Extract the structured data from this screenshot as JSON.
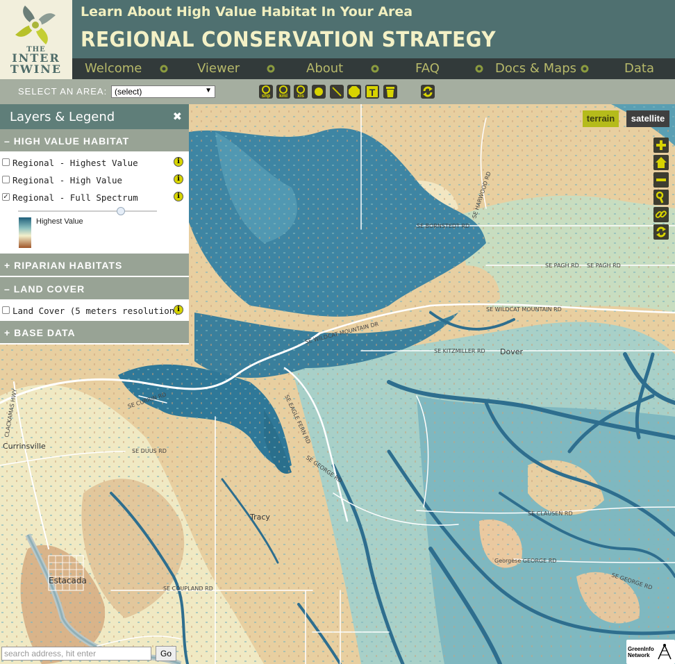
{
  "header": {
    "tagline": "Learn About High Value Habitat In Your Area",
    "title": "REGIONAL CONSERVATION STRATEGY",
    "logo": {
      "line1": "THE",
      "line2": "INTER",
      "line3": "TWINE"
    }
  },
  "nav": {
    "items": [
      {
        "label": "Welcome"
      },
      {
        "label": "Viewer"
      },
      {
        "label": "About"
      },
      {
        "label": "FAQ"
      },
      {
        "label": "Docs & Maps"
      },
      {
        "label": "Data"
      }
    ]
  },
  "toolbar": {
    "area_label": "SELECT AN AREA:",
    "area_value": "(select)",
    "tools": [
      {
        "icon": "shp-download-icon",
        "text": "shp"
      },
      {
        "icon": "kml-download-icon",
        "text": "kml"
      },
      {
        "icon": "xls-download-icon",
        "text": "xls"
      },
      {
        "icon": "draw-point-icon"
      },
      {
        "icon": "draw-line-icon"
      },
      {
        "icon": "draw-polygon-icon"
      },
      {
        "icon": "draw-text-icon",
        "text": "T"
      },
      {
        "icon": "trash-icon"
      },
      {
        "icon": "refresh-icon"
      }
    ]
  },
  "panel": {
    "title": "Layers & Legend",
    "sections": {
      "hvh": {
        "title": "HIGH VALUE HABITAT",
        "toggle": "–",
        "layers": [
          {
            "label": "Regional - Highest Value",
            "checked": false
          },
          {
            "label": "Regional - High Value",
            "checked": false
          },
          {
            "label": "Regional - Full Spectrum",
            "checked": true
          }
        ],
        "opacity": 0.74,
        "legend": "Highest Value"
      },
      "riparian": {
        "title": "RIPARIAN HABITATS",
        "toggle": "+"
      },
      "landcover": {
        "title": "LAND COVER",
        "toggle": "–",
        "layers": [
          {
            "label": "Land Cover (5 meters resolution)",
            "checked": false
          }
        ]
      },
      "basedata": {
        "title": "BASE DATA",
        "toggle": "+"
      }
    }
  },
  "map": {
    "basemaps": {
      "terrain": "terrain",
      "satellite": "satellite"
    },
    "controls": [
      "zoom-in-icon",
      "home-icon",
      "zoom-out-icon",
      "identify-icon",
      "link-icon",
      "refresh-icon"
    ],
    "places": [
      {
        "name": "Dover"
      },
      {
        "name": "Tracy"
      },
      {
        "name": "Currinsville"
      },
      {
        "name": "Estacada"
      }
    ],
    "roads": {
      "bornstedt": "SE BORNSTEDT RD",
      "pagh": "SE PAGH RD",
      "wildcat_dr": "SE WILDCAT MOUNTAIN DR",
      "wildcat_rd": "SE WILDCAT MOUNTAIN RD",
      "kitzmiller": "SE KITZMILLER RD",
      "currin": "SE CURRIN RD",
      "duus": "SE DUUS RD",
      "george": "SE GEORGE RD",
      "eagle_fern": "SE EAGLE FERN RD",
      "clausen": "SE CLAUSEN RD",
      "georgese": "Georgese GEORGE RD",
      "coupland": "SE COUPLAND RD",
      "clackamas_hwy": "CLACKAMAS HWY",
      "harwood": "SE HARWOOD RD"
    },
    "colors": {
      "high": "#2f7899",
      "mid": "#8fc2c0",
      "low": "#f3ecc8",
      "developed": "#e4c59a",
      "road": "#ffffff"
    }
  },
  "search": {
    "placeholder": "search address, hit enter",
    "go": "Go"
  },
  "credit": {
    "line1": "GreenInfo",
    "line2": "Network"
  }
}
